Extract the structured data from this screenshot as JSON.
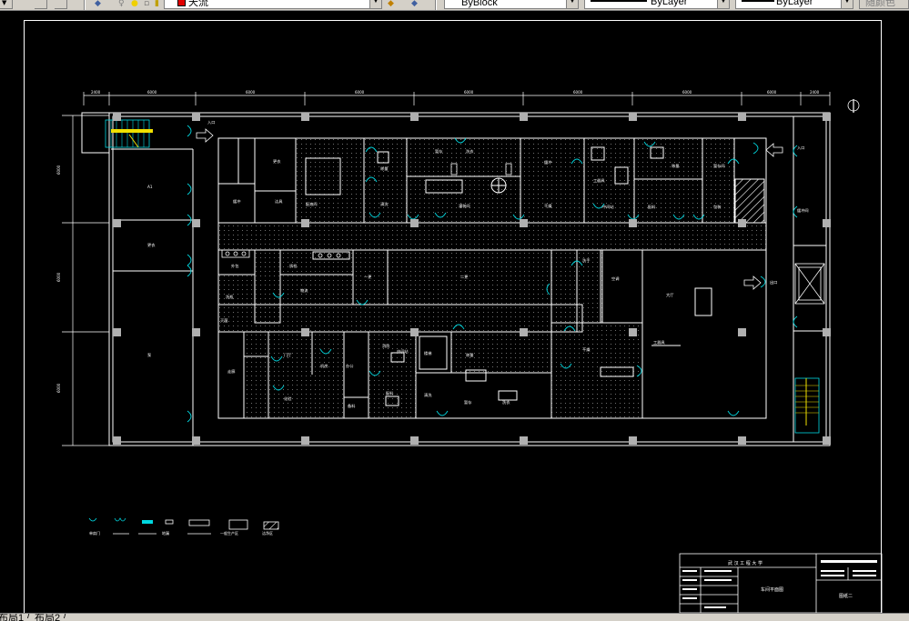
{
  "toolbar": {
    "layer_name": "天流",
    "color_value": "ByBlock",
    "linetype_value": "ByLayer",
    "lineweight_value": "ByLayer",
    "plotstyle_value": "随颜色",
    "colors": {
      "bg": "#d4d0c8",
      "layer_swatch": "#e00000",
      "lamp": "#f0d000"
    }
  },
  "drawing": {
    "north_symbol": "⊕",
    "dim_top": [
      "2400",
      "6000",
      "6000",
      "6000",
      "6000",
      "6000",
      "6000",
      "6000",
      "2400"
    ],
    "dim_left": [
      "6000",
      "6000",
      "6000"
    ],
    "rooms": {
      "r_a": "A1",
      "r_b": "更衣",
      "r_c": "泵",
      "r_lobby": "大厅",
      "r_stair_note": "楼梯",
      "r1": "更衣",
      "r2": "缓冲",
      "r3": "洁具",
      "r4": "配液间",
      "r5": "灌装间",
      "r6": "称量",
      "r7": "清洗",
      "r8": "暂存",
      "r9": "洗衣",
      "r10": "缓冲",
      "r11": "干燥",
      "r12": "工器具",
      "r13": "中间站",
      "r14": "配料",
      "r15": "称量",
      "r16": "暂存间",
      "r17": "包装",
      "r18": "外包",
      "r19": "洗瓶",
      "r20": "灭菌",
      "r21": "质检",
      "r22": "物流",
      "r23": "一更",
      "r24": "二更",
      "r25": "洗手",
      "r26": "空调",
      "r27": "走廊",
      "r28": "门厅",
      "r29": "机房",
      "r30": "化验",
      "r31": "办公",
      "r32": "备料",
      "r33": "消防",
      "r34": "缓冲间",
      "r35": "出口",
      "r36": "入口"
    },
    "entrance_label": "入口"
  },
  "legend": {
    "items": [
      "单扇门",
      "双扇门",
      "传递窗",
      "地漏",
      "回风口",
      "一般生产区",
      "洁净区"
    ],
    "colors": {
      "cyan": "#00d8e0"
    }
  },
  "title_block": {
    "school": "武 汉 工 程 大 学",
    "drawing_title": "车间平面图",
    "drawing_number": "图纸二"
  },
  "layout_tabs": [
    "布局1",
    "布局2"
  ]
}
